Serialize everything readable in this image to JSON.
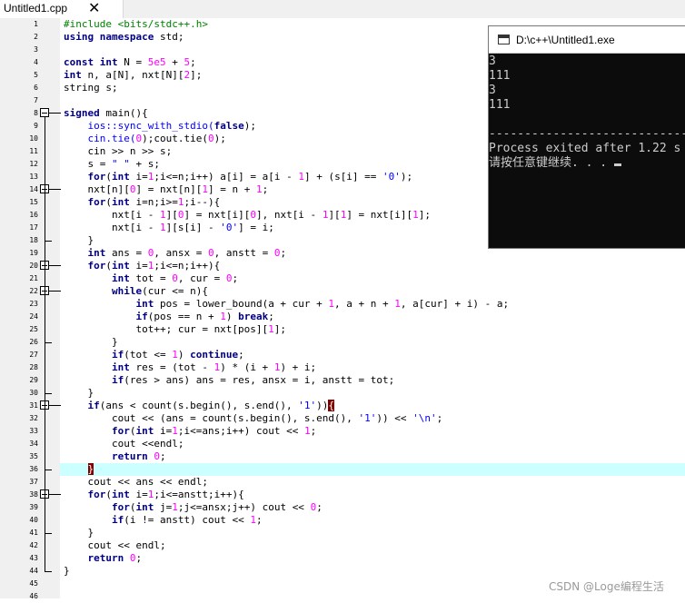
{
  "tab": {
    "title": "Untitled1.cpp",
    "close_glyph": "✕"
  },
  "editor": {
    "code": [
      [
        [
          "#include <bits/stdc++.h>",
          "pp"
        ]
      ],
      [
        [
          "using namespace",
          "kw"
        ],
        [
          " std;",
          ""
        ]
      ],
      [
        [
          "",
          ""
        ]
      ],
      [
        [
          "const int",
          "kw"
        ],
        [
          " N = ",
          ""
        ],
        [
          "5e5",
          "num"
        ],
        [
          " + ",
          ""
        ],
        [
          "5",
          "num"
        ],
        [
          ";",
          ""
        ]
      ],
      [
        [
          "int",
          "kw"
        ],
        [
          " n, a[N], nxt[N][",
          ""
        ],
        [
          "2",
          "num"
        ],
        [
          "];",
          ""
        ]
      ],
      [
        [
          "string s;",
          ""
        ]
      ],
      [
        [
          "",
          ""
        ]
      ],
      [
        [
          "signed",
          "kw"
        ],
        [
          " main(){",
          ""
        ]
      ],
      [
        [
          "    ios::sync_with_stdio(",
          "str"
        ],
        [
          "false",
          "kw"
        ],
        [
          ");",
          ""
        ]
      ],
      [
        [
          "    cin.tie(",
          "str"
        ],
        [
          "0",
          "num"
        ],
        [
          ");cout.tie(",
          ""
        ],
        [
          "0",
          "num"
        ],
        [
          ");",
          ""
        ]
      ],
      [
        [
          "    cin ",
          ""
        ],
        [
          ">>",
          ""
        ],
        [
          " n ",
          ""
        ],
        [
          ">>",
          ""
        ],
        [
          " s;",
          ""
        ]
      ],
      [
        [
          "    s = ",
          ""
        ],
        [
          "\" \"",
          "str"
        ],
        [
          " + s;",
          ""
        ]
      ],
      [
        [
          "    ",
          ""
        ],
        [
          "for",
          "kw"
        ],
        [
          "(",
          ""
        ],
        [
          "int",
          "kw"
        ],
        [
          " i=",
          ""
        ],
        [
          "1",
          "num"
        ],
        [
          ";i<=n;i++) a[i] = a[i - ",
          ""
        ],
        [
          "1",
          "num"
        ],
        [
          "] + (s[i] == ",
          ""
        ],
        [
          "'0'",
          "str"
        ],
        [
          ");",
          ""
        ]
      ],
      [
        [
          "    nxt[n][",
          ""
        ],
        [
          "0",
          "num"
        ],
        [
          "] = nxt[n][",
          ""
        ],
        [
          "1",
          "num"
        ],
        [
          "] = n + ",
          ""
        ],
        [
          "1",
          "num"
        ],
        [
          ";",
          ""
        ]
      ],
      [
        [
          "    ",
          ""
        ],
        [
          "for",
          "kw"
        ],
        [
          "(",
          ""
        ],
        [
          "int",
          "kw"
        ],
        [
          " i=n;i>=",
          ""
        ],
        [
          "1",
          "num"
        ],
        [
          ";i--){",
          ""
        ]
      ],
      [
        [
          "        nxt[i - ",
          ""
        ],
        [
          "1",
          "num"
        ],
        [
          "][",
          ""
        ],
        [
          "0",
          "num"
        ],
        [
          "] = nxt[i][",
          ""
        ],
        [
          "0",
          "num"
        ],
        [
          "], nxt[i - ",
          ""
        ],
        [
          "1",
          "num"
        ],
        [
          "][",
          ""
        ],
        [
          "1",
          "num"
        ],
        [
          "] = nxt[i][",
          ""
        ],
        [
          "1",
          "num"
        ],
        [
          "];",
          ""
        ]
      ],
      [
        [
          "        nxt[i - ",
          ""
        ],
        [
          "1",
          "num"
        ],
        [
          "][s[i] - ",
          ""
        ],
        [
          "'0'",
          "str"
        ],
        [
          "] = i;",
          ""
        ]
      ],
      [
        [
          "    }",
          ""
        ]
      ],
      [
        [
          "    ",
          ""
        ],
        [
          "int",
          "kw"
        ],
        [
          " ans = ",
          ""
        ],
        [
          "0",
          "num"
        ],
        [
          ", ansx = ",
          ""
        ],
        [
          "0",
          "num"
        ],
        [
          ", anstt = ",
          ""
        ],
        [
          "0",
          "num"
        ],
        [
          ";",
          ""
        ]
      ],
      [
        [
          "    ",
          ""
        ],
        [
          "for",
          "kw"
        ],
        [
          "(",
          ""
        ],
        [
          "int",
          "kw"
        ],
        [
          " i=",
          ""
        ],
        [
          "1",
          "num"
        ],
        [
          ";i<=n;i++){",
          ""
        ]
      ],
      [
        [
          "        ",
          ""
        ],
        [
          "int",
          "kw"
        ],
        [
          " tot = ",
          ""
        ],
        [
          "0",
          "num"
        ],
        [
          ", cur = ",
          ""
        ],
        [
          "0",
          "num"
        ],
        [
          ";",
          ""
        ]
      ],
      [
        [
          "        ",
          ""
        ],
        [
          "while",
          "kw"
        ],
        [
          "(cur <= n){",
          ""
        ]
      ],
      [
        [
          "            ",
          ""
        ],
        [
          "int",
          "kw"
        ],
        [
          " pos = lower_bound(a + cur + ",
          ""
        ],
        [
          "1",
          "num"
        ],
        [
          ", a + n + ",
          ""
        ],
        [
          "1",
          "num"
        ],
        [
          ", a[cur] + i) - a;",
          ""
        ]
      ],
      [
        [
          "            ",
          ""
        ],
        [
          "if",
          "kw"
        ],
        [
          "(pos == n + ",
          ""
        ],
        [
          "1",
          "num"
        ],
        [
          ") ",
          ""
        ],
        [
          "break",
          "kw"
        ],
        [
          ";",
          ""
        ]
      ],
      [
        [
          "            tot++; cur = nxt[pos][",
          ""
        ],
        [
          "1",
          "num"
        ],
        [
          "];",
          ""
        ]
      ],
      [
        [
          "        }",
          ""
        ]
      ],
      [
        [
          "        ",
          ""
        ],
        [
          "if",
          "kw"
        ],
        [
          "(tot <= ",
          ""
        ],
        [
          "1",
          "num"
        ],
        [
          ") ",
          ""
        ],
        [
          "continue",
          "kw"
        ],
        [
          ";",
          ""
        ]
      ],
      [
        [
          "        ",
          ""
        ],
        [
          "int",
          "kw"
        ],
        [
          " res = (tot - ",
          ""
        ],
        [
          "1",
          "num"
        ],
        [
          ") * (i + ",
          ""
        ],
        [
          "1",
          "num"
        ],
        [
          ") + i;",
          ""
        ]
      ],
      [
        [
          "        ",
          ""
        ],
        [
          "if",
          "kw"
        ],
        [
          "(res > ans) ans = res, ansx = i, anstt = tot;",
          ""
        ]
      ],
      [
        [
          "    }",
          ""
        ]
      ],
      [
        [
          "    ",
          ""
        ],
        [
          "if",
          "kw"
        ],
        [
          "(ans < count(s.begin(), s.end(), ",
          ""
        ],
        [
          "'1'",
          "str"
        ],
        [
          "))",
          ""
        ],
        [
          "{",
          "brh"
        ]
      ],
      [
        [
          "        cout << (ans = count(s.begin(), s.end(), ",
          ""
        ],
        [
          "'1'",
          "str"
        ],
        [
          ")) << ",
          ""
        ],
        [
          "'\\n'",
          "str"
        ],
        [
          ";",
          ""
        ]
      ],
      [
        [
          "        ",
          ""
        ],
        [
          "for",
          "kw"
        ],
        [
          "(",
          ""
        ],
        [
          "int",
          "kw"
        ],
        [
          " i=",
          ""
        ],
        [
          "1",
          "num"
        ],
        [
          ";i<=ans;i++) cout << ",
          ""
        ],
        [
          "1",
          "num"
        ],
        [
          ";",
          ""
        ]
      ],
      [
        [
          "        cout <<endl;",
          ""
        ]
      ],
      [
        [
          "        ",
          ""
        ],
        [
          "return",
          "kw"
        ],
        [
          " ",
          ""
        ],
        [
          "0",
          "num"
        ],
        [
          ";",
          ""
        ]
      ],
      [
        [
          "    ",
          ""
        ],
        [
          "}",
          "brh"
        ]
      ],
      [
        [
          "    cout << ans << endl;",
          ""
        ]
      ],
      [
        [
          "    ",
          ""
        ],
        [
          "for",
          "kw"
        ],
        [
          "(",
          ""
        ],
        [
          "int",
          "kw"
        ],
        [
          " i=",
          ""
        ],
        [
          "1",
          "num"
        ],
        [
          ";i<=anstt;i++){",
          ""
        ]
      ],
      [
        [
          "        ",
          ""
        ],
        [
          "for",
          "kw"
        ],
        [
          "(",
          ""
        ],
        [
          "int",
          "kw"
        ],
        [
          " j=",
          ""
        ],
        [
          "1",
          "num"
        ],
        [
          ";j<=ansx;j++) cout << ",
          ""
        ],
        [
          "0",
          "num"
        ],
        [
          ";",
          ""
        ]
      ],
      [
        [
          "        ",
          ""
        ],
        [
          "if",
          "kw"
        ],
        [
          "(i != anstt) cout << ",
          ""
        ],
        [
          "1",
          "num"
        ],
        [
          ";",
          ""
        ]
      ],
      [
        [
          "    }",
          ""
        ]
      ],
      [
        [
          "    cout << endl;",
          ""
        ]
      ],
      [
        [
          "    ",
          ""
        ],
        [
          "return",
          "kw"
        ],
        [
          " ",
          ""
        ],
        [
          "0",
          "num"
        ],
        [
          ";",
          ""
        ]
      ],
      [
        [
          "}",
          ""
        ]
      ],
      [
        [
          "",
          ""
        ]
      ],
      [
        [
          "",
          ""
        ]
      ]
    ],
    "current_line": 36
  },
  "console": {
    "title": "D:\\c++\\Untitled1.exe",
    "output": [
      "3",
      "111",
      "3",
      "111",
      "",
      "--------------------------------",
      "Process exited after 1.22 s",
      "请按任意键继续. . . "
    ]
  },
  "watermark": "CSDN @Loge编程生活",
  "colors": {
    "keyword": "#000080",
    "number": "#ff00ff",
    "string": "#0000ff",
    "preprocessor": "#008000",
    "current_line": "#ccffff",
    "bracket_match": "#800000"
  }
}
